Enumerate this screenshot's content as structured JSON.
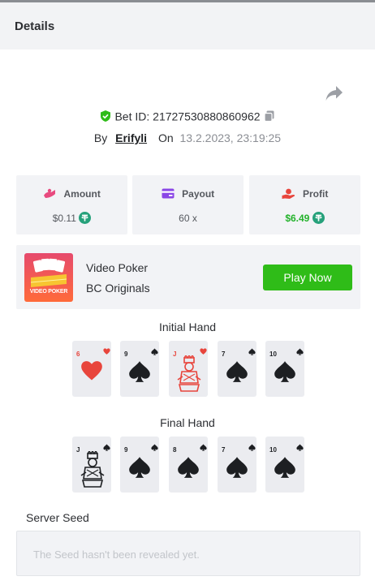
{
  "header": {
    "title": "Details"
  },
  "bet": {
    "id_label": "Bet ID:",
    "id_value": "21727530880860962",
    "by_label": "By",
    "user": "Erifyli",
    "on_label": "On",
    "date": "13.2.2023, 23:19:25"
  },
  "stats": {
    "amount": {
      "label": "Amount",
      "value": "$0.11"
    },
    "payout": {
      "label": "Payout",
      "value": "60 x"
    },
    "profit": {
      "label": "Profit",
      "value": "$6.49"
    }
  },
  "game": {
    "name": "Video Poker",
    "provider": "BC Originals",
    "logo_text": "VIDEO POKER",
    "play_label": "Play Now"
  },
  "initial_hand": {
    "label": "Initial Hand",
    "cards": [
      {
        "rank": "6",
        "suit": "heart",
        "color": "#e8453c"
      },
      {
        "rank": "9",
        "suit": "spade",
        "color": "#1d1f22"
      },
      {
        "rank": "J",
        "suit": "heart",
        "color": "#e8453c"
      },
      {
        "rank": "7",
        "suit": "spade",
        "color": "#1d1f22"
      },
      {
        "rank": "10",
        "suit": "spade",
        "color": "#1d1f22"
      }
    ]
  },
  "final_hand": {
    "label": "Final Hand",
    "cards": [
      {
        "rank": "J",
        "suit": "spade",
        "color": "#1d1f22"
      },
      {
        "rank": "9",
        "suit": "spade",
        "color": "#1d1f22"
      },
      {
        "rank": "8",
        "suit": "spade",
        "color": "#1d1f22"
      },
      {
        "rank": "7",
        "suit": "spade",
        "color": "#1d1f22"
      },
      {
        "rank": "10",
        "suit": "spade",
        "color": "#1d1f22"
      }
    ]
  },
  "seed": {
    "label": "Server Seed",
    "placeholder": "The Seed hasn't been revealed yet."
  },
  "colors": {
    "accent_green": "#2fbc18",
    "profit_green": "#23b22b",
    "tether": "#26a17b",
    "heart_red": "#e8453c"
  }
}
